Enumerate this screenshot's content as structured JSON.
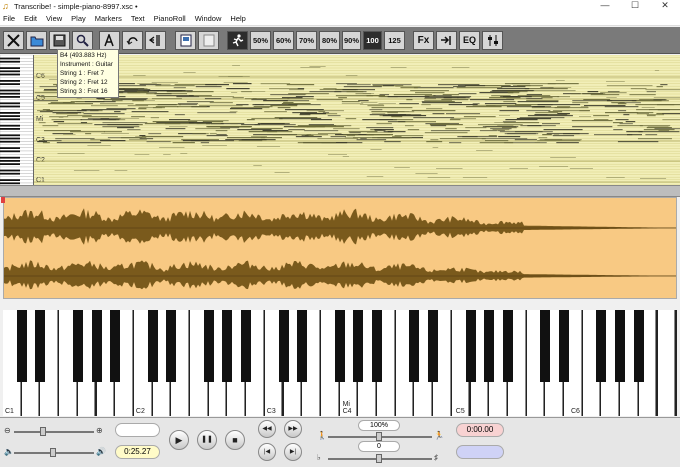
{
  "window": {
    "title": "Transcribe! - simple-piano-8997.xsc •",
    "minimize": "—",
    "maximize": "☐",
    "close": "✕"
  },
  "menu": [
    "File",
    "Edit",
    "View",
    "Play",
    "Markers",
    "Text",
    "PianoRoll",
    "Window",
    "Help"
  ],
  "toolbar": {
    "percent_buttons": [
      "50%",
      "60%",
      "70%",
      "80%",
      "90%",
      "100",
      "125"
    ],
    "fx_label": "Fx",
    "eq_label": "EQ"
  },
  "tooltip": {
    "lines": [
      "B4 (493.883 Hz)",
      "Instrument : Guitar",
      "String 1 : Fret 7",
      "String 2 : Fret 12",
      "String 3 : Fret 16"
    ]
  },
  "pianoroll": {
    "octave_labels": [
      "C6",
      "C5",
      "Mi",
      "C3",
      "C2",
      "C1"
    ],
    "background": "#f2efb8"
  },
  "waveform": {
    "color": "#7a5a1c",
    "background": "#f8c983"
  },
  "piano": {
    "labels": [
      "C1",
      "C2",
      "C3",
      "Mi",
      "C4",
      "C5",
      "C6"
    ]
  },
  "controls": {
    "time_position": "0:25.27",
    "speed_value": "100%",
    "pitch_value": "0",
    "time_display": "0:00.00",
    "loop_start": "",
    "loop_end": "",
    "icons": {
      "play": "▶",
      "pause": "❚❚",
      "stop": "■",
      "rewind": "◀◀",
      "forward": "▶▶",
      "prev": "|◀",
      "next": "▶|"
    }
  }
}
